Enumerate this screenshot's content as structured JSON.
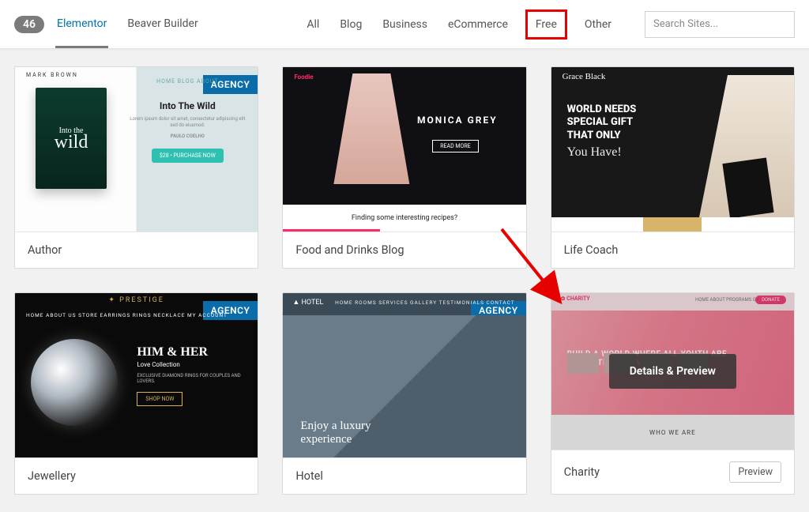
{
  "topbar": {
    "count": "46",
    "builders": [
      "Elementor",
      "Beaver Builder"
    ],
    "active_builder": 0,
    "filters": [
      "All",
      "Blog",
      "Business",
      "eCommerce",
      "Free",
      "Other"
    ],
    "highlighted_filter": 4,
    "search_placeholder": "Search Sites..."
  },
  "badges": {
    "agency": "AGENCY"
  },
  "overlay": {
    "details_preview": "Details & Preview",
    "preview": "Preview"
  },
  "cards": [
    {
      "title": "Author",
      "badge": "agency",
      "thumb": {
        "brand": "MARK BROWN",
        "nav": "HOME   BLOG   ABOUT",
        "book_into": "Into the",
        "book_wild": "wild",
        "heading": "Into The Wild",
        "paragraph": "Lorem ipsum dolor sit amet, consectetur adipiscing elit sed do eiusmod.",
        "author_credit": "PAULO COELHO",
        "button": "$28 • PURCHASE NOW"
      }
    },
    {
      "title": "Food and Drinks Blog",
      "badge": "agency",
      "thumb": {
        "logo": "Foodie",
        "name": "MONICA GREY",
        "hero_button": "READ MORE",
        "tagline": "Finding some interesting recipes?"
      }
    },
    {
      "title": "Life Coach",
      "badge": "agency",
      "thumb": {
        "brand": "Grace Black",
        "line1": "WORLD NEEDS",
        "line2": "SPECIAL GIFT",
        "line3": "THAT ONLY",
        "cursive": "You Have!"
      }
    },
    {
      "title": "Jewellery",
      "badge": "agency",
      "thumb": {
        "logo": "✦ PRESTIGE",
        "nav": "HOME   ABOUT US   STORE   EARRINGS   RINGS   NECKLACE   MY ACCOUNT",
        "heading": "HIM & HER",
        "sub": "Love Collection",
        "small": "EXCLUSIVE DIAMOND RINGS FOR COUPLES AND LOVERS.",
        "button": "SHOP NOW"
      }
    },
    {
      "title": "Hotel",
      "badge": "agency",
      "thumb": {
        "logo": "▲ HOTEL",
        "nav": "HOME   ROOMS   SERVICES   GALLERY   TESTIMONIALS   CONTACT",
        "line1": "Enjoy a luxury",
        "line2": "experience"
      }
    },
    {
      "title": "Charity",
      "badge": null,
      "hovered": true,
      "thumb": {
        "logo": "✿ CHARITY",
        "nav": "HOME   ABOUT   PROGRAMS   GET INVOLVED",
        "donate": "DONATE",
        "headline": "BUILD A WORLD WHERE ALL YOUTH ARE SAFE, STRONG & VALUED",
        "who": "WHO WE ARE"
      }
    }
  ]
}
